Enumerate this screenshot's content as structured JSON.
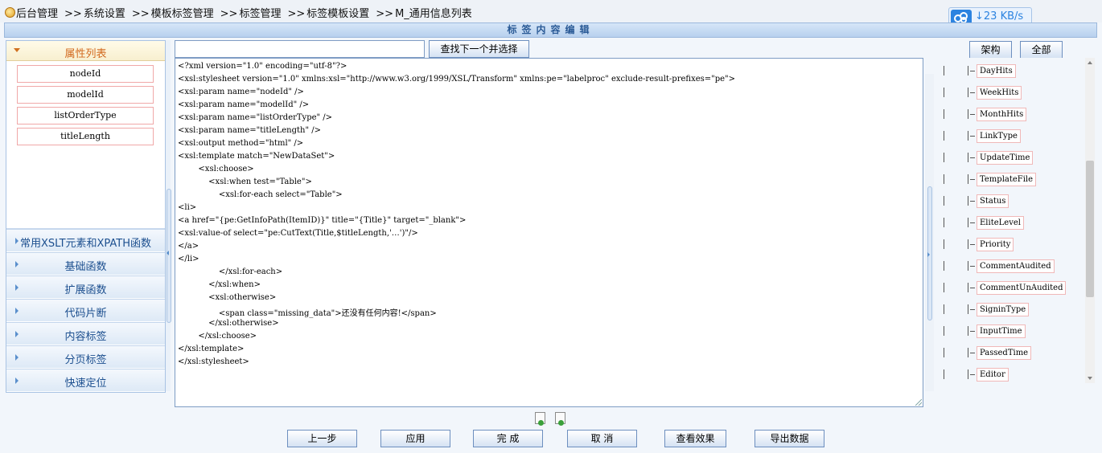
{
  "breadcrumb": {
    "items": [
      "后台管理",
      "系统设置",
      "模板标签管理",
      "标签管理",
      "标签模板设置",
      "M_通用信息列表"
    ],
    "separator": ">>"
  },
  "speed_widget": {
    "text": "↓23 KB/s"
  },
  "panel_title": "标签内容编辑",
  "left_panel": {
    "attributes_header": "属性列表",
    "attributes": [
      "nodeId",
      "modelId",
      "listOrderType",
      "titleLength"
    ],
    "accordion": [
      "常用XSLT元素和XPATH函数",
      "基础函数",
      "扩展函数",
      "代码片断",
      "内容标签",
      "分页标签",
      "快速定位"
    ]
  },
  "search": {
    "value": "",
    "button": "查找下一个并选择"
  },
  "editor": {
    "lines": [
      "<?xml version=\"1.0\" encoding=\"utf-8\"?>",
      "<xsl:stylesheet version=\"1.0\" xmlns:xsl=\"http://www.w3.org/1999/XSL/Transform\" xmlns:pe=\"labelproc\" exclude-result-prefixes=\"pe\">",
      "<xsl:param name=\"nodeId\" />",
      "<xsl:param name=\"modelId\" />",
      "<xsl:param name=\"listOrderType\" />",
      "<xsl:param name=\"titleLength\" />",
      "<xsl:output method=\"html\" />",
      "<xsl:template match=\"NewDataSet\">",
      "        <xsl:choose>",
      "            <xsl:when test=\"Table\">",
      "                <xsl:for-each select=\"Table\">",
      "<li>",
      "<a href=\"{pe:GetInfoPath(ItemID)}\" title=\"{Title}\" target=\"_blank\">",
      "<xsl:value-of select=\"pe:CutText(Title,$titleLength,'…')\"/>",
      "</a>",
      "</li>",
      "                </xsl:for-each>",
      "            </xsl:when>",
      "            <xsl:otherwise>",
      "                <span class=\"missing_data\">还没有任何内容!</span>",
      "            </xsl:otherwise>",
      "        </xsl:choose>",
      "</xsl:template>",
      "</xsl:stylesheet>"
    ]
  },
  "right_panel": {
    "buttons": [
      "架构",
      "全部"
    ],
    "fields": [
      "DayHits",
      "WeekHits",
      "MonthHits",
      "LinkType",
      "UpdateTime",
      "TemplateFile",
      "Status",
      "EliteLevel",
      "Priority",
      "CommentAudited",
      "CommentUnAudited",
      "SigninType",
      "InputTime",
      "PassedTime",
      "Editor"
    ]
  },
  "bottom_buttons": [
    "上一步",
    "应用",
    "完 成",
    "取 消",
    "查看效果",
    "导出数据"
  ],
  "colors": {
    "title_text": "#2a5a96",
    "accent_orange": "#d2691e",
    "accordion_text": "#1c4f8f",
    "speed_blue": "#2c83e0"
  }
}
